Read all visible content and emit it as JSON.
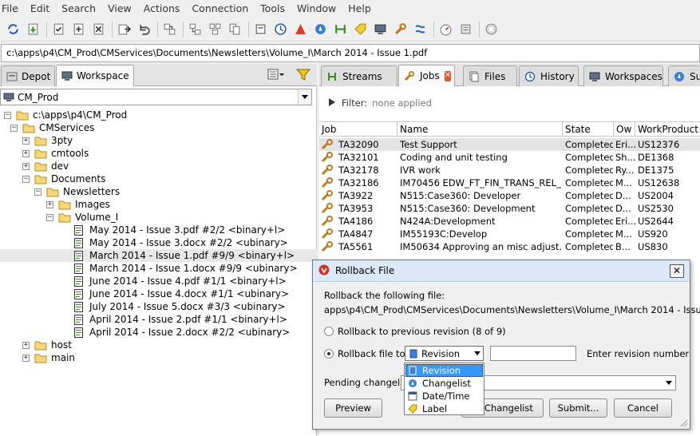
{
  "menu": [
    "File",
    "Edit",
    "Search",
    "View",
    "Actions",
    "Connection",
    "Tools",
    "Window",
    "Help"
  ],
  "path_bar": "c:\\apps\\p4\\CM_Prod\\CMServices\\Documents\\Newsletters\\Volume_I\\March 2014 - Issue 1.pdf",
  "left_tabs": {
    "depot": "Depot",
    "workspace": "Workspace"
  },
  "workspace_combo": "CM_Prod",
  "tree": [
    {
      "label": "c:\\apps\\p4\\CM_Prod",
      "toggle": "-",
      "kind": "folder"
    },
    {
      "label": "CMServices",
      "toggle": "-",
      "kind": "folder"
    },
    {
      "label": "3pty",
      "toggle": "+",
      "kind": "folder"
    },
    {
      "label": "cmtools",
      "toggle": "+",
      "kind": "folder"
    },
    {
      "label": "dev",
      "toggle": "+",
      "kind": "folder"
    },
    {
      "label": "Documents",
      "toggle": "-",
      "kind": "folder"
    },
    {
      "label": "Newsletters",
      "toggle": "-",
      "kind": "folder"
    },
    {
      "label": "Images",
      "toggle": "+",
      "kind": "folder"
    },
    {
      "label": "Volume_I",
      "toggle": "-",
      "kind": "folder"
    },
    {
      "label": "May 2014 - Issue 3.pdf #2/2 <binary+l>",
      "kind": "file"
    },
    {
      "label": "May 2014 - Issue 3.docx #2/2 <ubinary>",
      "kind": "file"
    },
    {
      "label": "March 2014 - Issue 1.pdf #9/9 <binary+l>",
      "kind": "file",
      "selected": true
    },
    {
      "label": "March 2014 - Issue 1.docx #9/9 <ubinary>",
      "kind": "file"
    },
    {
      "label": "June 2014 - Issue 4.pdf #1/1 <binary+l>",
      "kind": "file"
    },
    {
      "label": "June 2014 - Issue 4.docx #1/1 <ubinary>",
      "kind": "file"
    },
    {
      "label": "July 2014 - Issue 5.docx #3/3 <ubinary>",
      "kind": "file"
    },
    {
      "label": "April 2014 - Issue 2.pdf #1/1 <binary+l>",
      "kind": "file"
    },
    {
      "label": "April 2014 - Issue 2.docx #2/2 <ubinary>",
      "kind": "file"
    },
    {
      "label": "host",
      "toggle": "+",
      "kind": "folder"
    },
    {
      "label": "main",
      "toggle": "+",
      "kind": "folder"
    }
  ],
  "right_tabs": [
    "Streams",
    "Jobs",
    "Files",
    "History",
    "Workspaces",
    "Su"
  ],
  "filter": {
    "label": "Filter:",
    "value": "none applied"
  },
  "jobs_columns": [
    "Job",
    "Name",
    "State",
    "Ow",
    "WorkProduct"
  ],
  "jobs_rows": [
    {
      "job": "TA32090",
      "name": "Test Support",
      "state": "Completed",
      "owner": "Eri...",
      "wp": "US12376"
    },
    {
      "job": "TA32101",
      "name": "Coding and unit testing",
      "state": "Completed",
      "owner": "Sh...",
      "wp": "DE1368"
    },
    {
      "job": "TA32178",
      "name": "IVR work",
      "state": "Completed",
      "owner": "Ry...",
      "wp": "DE1375"
    },
    {
      "job": "TA32186",
      "name": "IM70456 EDW_FT_FIN_TRANS_REL_S...",
      "state": "Completed",
      "owner": "M...",
      "wp": "US12638"
    },
    {
      "job": "TA3922",
      "name": "N515:Case360: Developer",
      "state": "Completed",
      "owner": "D...",
      "wp": "US2004"
    },
    {
      "job": "TA3953",
      "name": "N515:Case360: Development",
      "state": "Completed",
      "owner": "D...",
      "wp": "US2530"
    },
    {
      "job": "TA4186",
      "name": "N424A:Development",
      "state": "Completed",
      "owner": "Eri...",
      "wp": "US2644"
    },
    {
      "job": "TA4847",
      "name": "IM55193C:Develop",
      "state": "Completed",
      "owner": "M...",
      "wp": "US920"
    },
    {
      "job": "TA5561",
      "name": "IM50634 Approving an misc adjust...",
      "state": "Completed",
      "owner": "B...",
      "wp": "US830"
    }
  ],
  "dialog": {
    "title": "Rollback File",
    "prompt": "Rollback the following file:",
    "file": "apps\\p4\\CM_Prod\\CMServices\\Documents\\Newsletters\\Volume_I\\March 2014 - Issue 1.pdf",
    "opt_prev": "Rollback to previous revision (8 of 9)",
    "opt_to": "Rollback file to:",
    "combo_value": "Revision",
    "enter_label": "Enter revision number",
    "pending_label": "Pending changelist:",
    "buttons": {
      "preview": "Preview",
      "changelist": "e to Changelist",
      "submit": "Submit...",
      "cancel": "Cancel"
    }
  },
  "dropdown_options": [
    "Revision",
    "Changelist",
    "Date/Time",
    "Label"
  ]
}
